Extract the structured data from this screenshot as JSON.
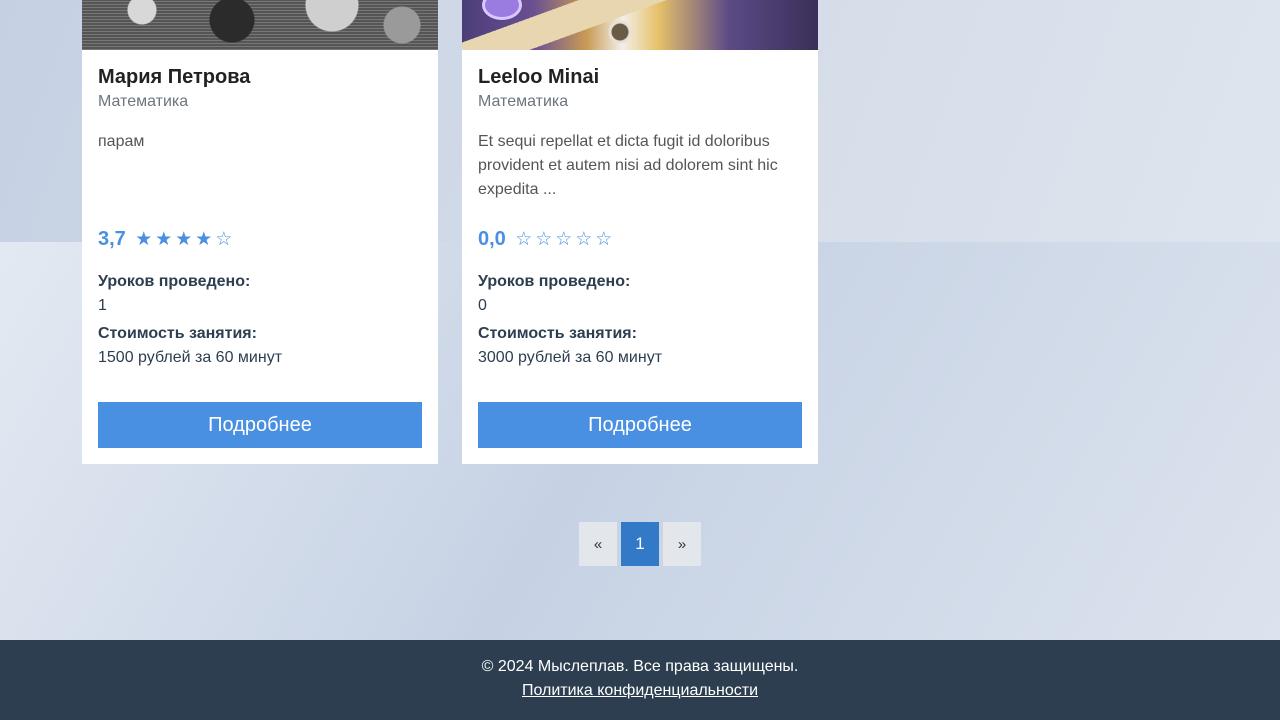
{
  "cards": [
    {
      "name": "Мария Петрова",
      "subject": "Математика",
      "description": "парам",
      "rating_value": "3,7",
      "stars": [
        "★",
        "★",
        "★",
        "★",
        "☆"
      ],
      "lessons_label": "Уроков проведено:",
      "lessons_value": "1",
      "price_label": "Стоимость занятия:",
      "price_value": "1500 рублей за 60 минут",
      "button_label": "Подробнее"
    },
    {
      "name": "Leeloo Minai",
      "subject": "Математика",
      "description": "Et sequi repellat et dicta fugit id doloribus provident et autem nisi ad dolorem sint hic expedita ...",
      "rating_value": "0,0",
      "stars": [
        "☆",
        "☆",
        "☆",
        "☆",
        "☆"
      ],
      "lessons_label": "Уроков проведено:",
      "lessons_value": "0",
      "price_label": "Стоимость занятия:",
      "price_value": "3000 рублей за 60 минут",
      "button_label": "Подробнее"
    }
  ],
  "pagination": {
    "prev": "«",
    "current": "1",
    "next": "»"
  },
  "footer": {
    "copyright": "© 2024 Мыслеплав. Все права защищены.",
    "privacy_link": "Политика конфиденциальности"
  },
  "colors": {
    "accent": "#4a90e2",
    "active_page": "#3279c7",
    "footer_bg": "#2c3e50"
  }
}
